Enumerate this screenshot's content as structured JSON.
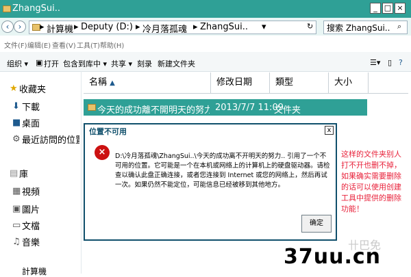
{
  "window": {
    "title": "ZhangSui..",
    "min": "_",
    "max": "□",
    "close": "×"
  },
  "address": {
    "back": "‹",
    "forward": "›",
    "dropdown": "▾",
    "crumbs": [
      "▸",
      "計算機",
      "▸",
      "Deputy (D:)",
      "▸",
      "冷月落孤魂",
      "▸",
      "ZhangSui..",
      "▾"
    ],
    "search_placeholder": "搜索 ZhangSui.."
  },
  "menu": [
    "文件(F)",
    "编辑(E)",
    "查看(V)",
    "工具(T)",
    "帮助(H)"
  ],
  "toolbar": {
    "organize": "组织 ▾",
    "open": "打开",
    "include": "包含到库中 ▾",
    "share": "共享 ▾",
    "burn": "刻录",
    "new_folder": "新建文件夹"
  },
  "sidebar": {
    "favorites": "收藏夹",
    "downloads": "下載",
    "desktop": "桌面",
    "recent": "最近訪問的位置",
    "library": "庫",
    "videos": "視頻",
    "pictures": "圖片",
    "documents": "文檔",
    "music": "音樂",
    "computer": "計算機"
  },
  "columns": {
    "name": "名稱",
    "date": "修改日期",
    "type": "類型",
    "size": "大小"
  },
  "row": {
    "name": "今天的成功離不開明天的努力..",
    "date": "2013/7/7 11:09",
    "type": "文件夹"
  },
  "dialog": {
    "title": "位置不可用",
    "close": "x",
    "icon": "×",
    "message": "D:\\冷月落孤魂\\ZhangSui..\\今天的成功离不开明天的努力.. 引用了一个不可用的位置。它可能是一个在本机或网络上的计算机上的硬盘驱动器。请检查以确认此盘正确连接，或者您连接到 Internet 或您的网络上，然后再试一次。如果仍然不能定位，可能信息已经被移到其他地方。",
    "ok": "确定"
  },
  "annotation": "这样的文件夹别人打不开也删不掉，如果确实需要删除的话可以使用创建工具中提供的删除功能！",
  "watermark": {
    "logo": "37uu.cn",
    "ghost": "卄巴免"
  }
}
